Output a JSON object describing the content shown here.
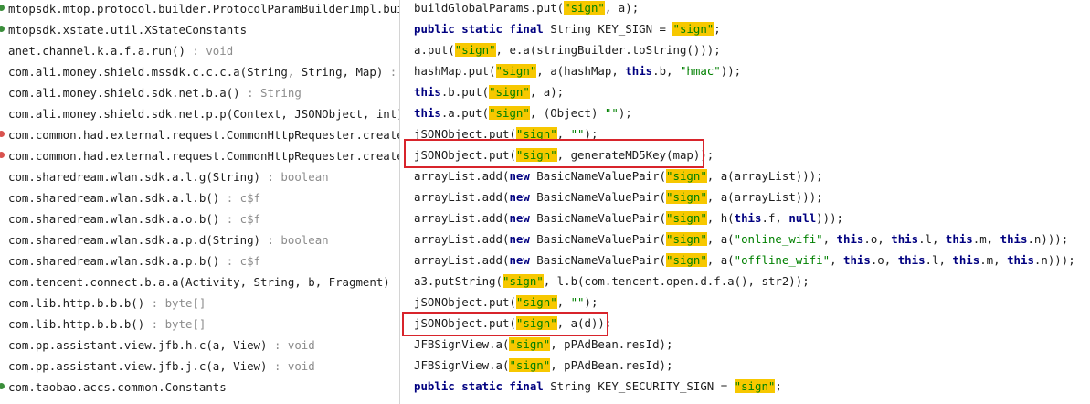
{
  "usages": [
    {
      "text": "mtopsdk.mtop.protocol.builder.ProtocolParamBuilderImpl.buildM",
      "suffix": "",
      "marker": "#3b8e3b"
    },
    {
      "text": "mtopsdk.xstate.util.XStateConstants",
      "suffix": "",
      "marker": "#3b8e3b"
    },
    {
      "text": "anet.channel.k.a.f.a.run()",
      "suffix": " : void",
      "marker": ""
    },
    {
      "text": "com.ali.money.shield.mssdk.c.c.c.a(String, String, Map)",
      "suffix": " : d",
      "marker": ""
    },
    {
      "text": "com.ali.money.shield.sdk.net.b.a()",
      "suffix": " : String",
      "marker": ""
    },
    {
      "text": "com.ali.money.shield.sdk.net.p.p(Context, JSONObject, int)",
      "suffix": " :",
      "marker": ""
    },
    {
      "text": "com.common.had.external.request.CommonHttpRequester.createReq",
      "suffix": "",
      "marker": "#d9534f"
    },
    {
      "text": "com.common.had.external.request.CommonHttpRequester.createReq",
      "suffix": "",
      "marker": "#d9534f"
    },
    {
      "text": "com.sharedream.wlan.sdk.a.l.g(String)",
      "suffix": " : boolean",
      "marker": ""
    },
    {
      "text": "com.sharedream.wlan.sdk.a.l.b()",
      "suffix": " : c$f",
      "marker": ""
    },
    {
      "text": "com.sharedream.wlan.sdk.a.o.b()",
      "suffix": " : c$f",
      "marker": ""
    },
    {
      "text": "com.sharedream.wlan.sdk.a.p.d(String)",
      "suffix": " : boolean",
      "marker": ""
    },
    {
      "text": "com.sharedream.wlan.sdk.a.p.b()",
      "suffix": " : c$f",
      "marker": ""
    },
    {
      "text": "com.tencent.connect.b.a.a(Activity, String, b, Fragment)",
      "suffix": " : in",
      "marker": ""
    },
    {
      "text": "com.lib.http.b.b.b()",
      "suffix": " : byte[]",
      "marker": ""
    },
    {
      "text": "com.lib.http.b.b.b()",
      "suffix": " : byte[]",
      "marker": ""
    },
    {
      "text": "com.pp.assistant.view.jfb.h.c(a, View)",
      "suffix": " : void",
      "marker": ""
    },
    {
      "text": "com.pp.assistant.view.jfb.j.c(a, View)",
      "suffix": " : void",
      "marker": ""
    },
    {
      "text": "com.taobao.accs.common.Constants",
      "suffix": "",
      "marker": "#3b8e3b"
    }
  ],
  "code": [
    [
      {
        "t": "buildGlobalParams.put("
      },
      {
        "t": "\"sign\"",
        "c": "hl"
      },
      {
        "t": ", a);"
      }
    ],
    [
      {
        "t": "public static final ",
        "c": "kw"
      },
      {
        "t": "String KEY_SIGN = "
      },
      {
        "t": "\"sign\"",
        "c": "hl"
      },
      {
        "t": ";"
      }
    ],
    [
      {
        "t": "a.put("
      },
      {
        "t": "\"sign\"",
        "c": "hl"
      },
      {
        "t": ", e.a(stringBuilder.toString()));"
      }
    ],
    [
      {
        "t": "hashMap.put("
      },
      {
        "t": "\"sign\"",
        "c": "hl"
      },
      {
        "t": ", a(hashMap, "
      },
      {
        "t": "this",
        "c": "kw"
      },
      {
        "t": ".b, "
      },
      {
        "t": "\"hmac\"",
        "c": "str"
      },
      {
        "t": "));"
      }
    ],
    [
      {
        "t": "this",
        "c": "kw"
      },
      {
        "t": ".b.put("
      },
      {
        "t": "\"sign\"",
        "c": "hl"
      },
      {
        "t": ", a);"
      }
    ],
    [
      {
        "t": "this",
        "c": "kw"
      },
      {
        "t": ".a.put("
      },
      {
        "t": "\"sign\"",
        "c": "hl"
      },
      {
        "t": ", (Object) "
      },
      {
        "t": "\"\"",
        "c": "str"
      },
      {
        "t": ");"
      }
    ],
    [
      {
        "t": "jSONObject.put("
      },
      {
        "t": "\"sign\"",
        "c": "hl"
      },
      {
        "t": ", "
      },
      {
        "t": "\"\"",
        "c": "str"
      },
      {
        "t": ");"
      }
    ],
    [
      {
        "t": "jSONObject.put("
      },
      {
        "t": "\"sign\"",
        "c": "hl"
      },
      {
        "t": ", generateMD5Key(map));"
      }
    ],
    [
      {
        "t": "arrayList.add("
      },
      {
        "t": "new ",
        "c": "kw"
      },
      {
        "t": "BasicNameValuePair("
      },
      {
        "t": "\"sign\"",
        "c": "hl"
      },
      {
        "t": ", a(arrayList)));"
      }
    ],
    [
      {
        "t": "arrayList.add("
      },
      {
        "t": "new ",
        "c": "kw"
      },
      {
        "t": "BasicNameValuePair("
      },
      {
        "t": "\"sign\"",
        "c": "hl"
      },
      {
        "t": ", a(arrayList)));"
      }
    ],
    [
      {
        "t": "arrayList.add("
      },
      {
        "t": "new ",
        "c": "kw"
      },
      {
        "t": "BasicNameValuePair("
      },
      {
        "t": "\"sign\"",
        "c": "hl"
      },
      {
        "t": ", h("
      },
      {
        "t": "this",
        "c": "kw"
      },
      {
        "t": ".f, "
      },
      {
        "t": "null",
        "c": "kw"
      },
      {
        "t": ")));"
      }
    ],
    [
      {
        "t": "arrayList.add("
      },
      {
        "t": "new ",
        "c": "kw"
      },
      {
        "t": "BasicNameValuePair("
      },
      {
        "t": "\"sign\"",
        "c": "hl"
      },
      {
        "t": ", a("
      },
      {
        "t": "\"online_wifi\"",
        "c": "str"
      },
      {
        "t": ", "
      },
      {
        "t": "this",
        "c": "kw"
      },
      {
        "t": ".o, "
      },
      {
        "t": "this",
        "c": "kw"
      },
      {
        "t": ".l, "
      },
      {
        "t": "this",
        "c": "kw"
      },
      {
        "t": ".m, "
      },
      {
        "t": "this",
        "c": "kw"
      },
      {
        "t": ".n)));"
      }
    ],
    [
      {
        "t": "arrayList.add("
      },
      {
        "t": "new ",
        "c": "kw"
      },
      {
        "t": "BasicNameValuePair("
      },
      {
        "t": "\"sign\"",
        "c": "hl"
      },
      {
        "t": ", a("
      },
      {
        "t": "\"offline_wifi\"",
        "c": "str"
      },
      {
        "t": ", "
      },
      {
        "t": "this",
        "c": "kw"
      },
      {
        "t": ".o, "
      },
      {
        "t": "this",
        "c": "kw"
      },
      {
        "t": ".l, "
      },
      {
        "t": "this",
        "c": "kw"
      },
      {
        "t": ".m, "
      },
      {
        "t": "this",
        "c": "kw"
      },
      {
        "t": ".n)));"
      }
    ],
    [
      {
        "t": "a3.putString("
      },
      {
        "t": "\"sign\"",
        "c": "hl"
      },
      {
        "t": ", l.b(com.tencent.open.d.f.a(), str2));"
      }
    ],
    [
      {
        "t": "jSONObject.put("
      },
      {
        "t": "\"sign\"",
        "c": "hl"
      },
      {
        "t": ", "
      },
      {
        "t": "\"\"",
        "c": "str"
      },
      {
        "t": ");"
      }
    ],
    [
      {
        "t": "jSONObject.put("
      },
      {
        "t": "\"sign\"",
        "c": "hl"
      },
      {
        "t": ", a(d));"
      }
    ],
    [
      {
        "t": "JFBSignView.a("
      },
      {
        "t": "\"sign\"",
        "c": "hl"
      },
      {
        "t": ", pPAdBean.resId);"
      }
    ],
    [
      {
        "t": "JFBSignView.a("
      },
      {
        "t": "\"sign\"",
        "c": "hl"
      },
      {
        "t": ", pPAdBean.resId);"
      }
    ],
    [
      {
        "t": "public static final ",
        "c": "kw"
      },
      {
        "t": "String KEY_SECURITY_SIGN = "
      },
      {
        "t": "\"sign\"",
        "c": "hl"
      },
      {
        "t": ";"
      }
    ]
  ],
  "colors": {
    "highlight": "#f7c800",
    "box": "#d8242b",
    "keyword": "#000080",
    "string": "#008000"
  }
}
